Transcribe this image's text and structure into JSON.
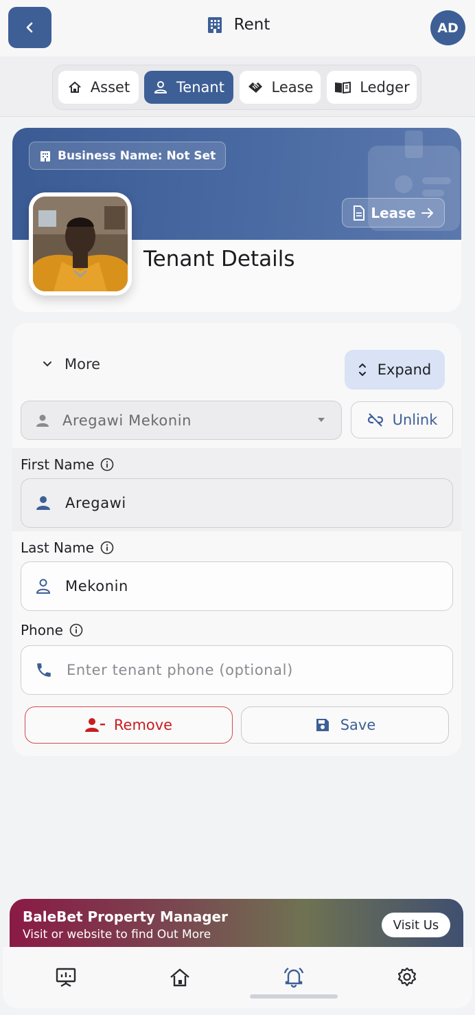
{
  "header": {
    "title": "Rent",
    "avatar_initials": "AD"
  },
  "tabs": [
    {
      "label": "Asset",
      "active": false
    },
    {
      "label": "Tenant",
      "active": true
    },
    {
      "label": "Lease",
      "active": false
    },
    {
      "label": "Ledger",
      "active": false
    }
  ],
  "tenant_card": {
    "business_name": "Business Name: Not Set",
    "lease_button": "Lease",
    "title": "Tenant Details"
  },
  "form": {
    "more_label": "More",
    "expand_label": "Expand",
    "selected_tenant": "Aregawi Mekonin",
    "unlink_label": "Unlink",
    "first_name_label": "First Name",
    "first_name_value": "Aregawi",
    "last_name_label": "Last Name",
    "last_name_value": "Mekonin",
    "phone_label": "Phone",
    "phone_placeholder": "Enter tenant phone (optional)",
    "remove_label": "Remove",
    "save_label": "Save"
  },
  "promo": {
    "title": "BaleBet Property Manager",
    "subtitle": "Visit or website to find Out More",
    "button": "Visit Us"
  },
  "bottom_nav": [
    "dashboard-icon",
    "home-icon",
    "notification-bell-icon",
    "settings-gear-icon"
  ],
  "colors": {
    "primary": "#3d5f96",
    "danger": "#c81e1e",
    "expand_bg": "#d9e3f5"
  }
}
